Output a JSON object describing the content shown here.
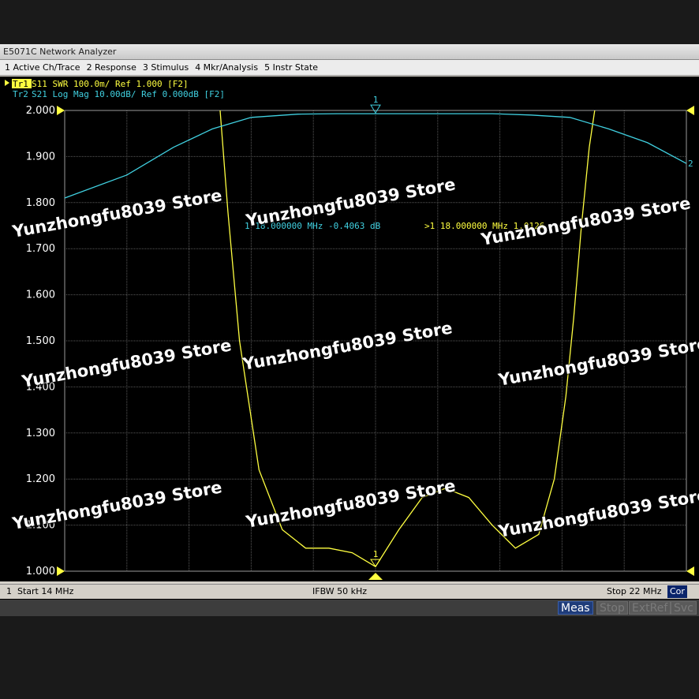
{
  "window": {
    "title": "E5071C Network Analyzer"
  },
  "menu": [
    "1 Active Ch/Trace",
    "2 Response",
    "3 Stimulus",
    "4 Mkr/Analysis",
    "5 Instr State"
  ],
  "traces": {
    "tr1": {
      "tag": "Tr1",
      "text": " S11  SWR 100.0m/ Ref 1.000 [F2]",
      "color": "#ffff40"
    },
    "tr2": {
      "tag": "Tr2",
      "text": " S21  Log Mag 10.00dB/ Ref 0.000dB [F2]",
      "color": "#40d0e0"
    }
  },
  "markers": {
    "readout_tr2": "1  18.000000 MHz -0.4063 dB",
    "readout_tr1": ">1  18.000000 MHz  1.0126",
    "label": "1",
    "tr2_end_label": "2"
  },
  "chart_data": {
    "type": "line",
    "x_range": [
      14,
      22
    ],
    "x_unit": "MHz",
    "y_ticks": [
      "2.000",
      "1.900",
      "1.800",
      "1.700",
      "1.600",
      "1.500",
      "1.400",
      "1.300",
      "1.200",
      "1.100",
      "1.000"
    ],
    "ylim": [
      1.0,
      2.0
    ],
    "grid": true,
    "series": [
      {
        "name": "Tr1",
        "x": [
          16.0,
          16.1,
          16.25,
          16.5,
          16.8,
          17.1,
          17.4,
          17.7,
          18.0,
          18.3,
          18.6,
          18.9,
          19.2,
          19.5,
          19.8,
          20.1,
          20.3,
          20.45,
          20.55,
          20.65,
          20.75,
          20.82
        ],
        "y": [
          2.0,
          1.78,
          1.5,
          1.22,
          1.09,
          1.05,
          1.05,
          1.04,
          1.01,
          1.09,
          1.16,
          1.18,
          1.16,
          1.1,
          1.05,
          1.08,
          1.2,
          1.38,
          1.55,
          1.75,
          1.92,
          2.0
        ]
      },
      {
        "name": "Tr2",
        "x": [
          14.0,
          14.8,
          15.4,
          15.9,
          16.4,
          17.0,
          17.5,
          18.0,
          18.5,
          19.0,
          19.5,
          20.0,
          20.5,
          21.0,
          21.5,
          22.0
        ],
        "y": [
          1.81,
          1.86,
          1.92,
          1.96,
          1.985,
          1.992,
          1.993,
          1.993,
          1.993,
          1.993,
          1.993,
          1.99,
          1.985,
          1.96,
          1.93,
          1.885
        ]
      }
    ]
  },
  "status": {
    "channel": "1",
    "start": "Start 14 MHz",
    "ifbw": "IFBW 50 kHz",
    "stop": "Stop 22 MHz",
    "cor": "Cor"
  },
  "softkeys": [
    "Meas",
    "Stop",
    "ExtRef",
    "Svc"
  ],
  "watermark": "Yunzhongfu8039 Store"
}
